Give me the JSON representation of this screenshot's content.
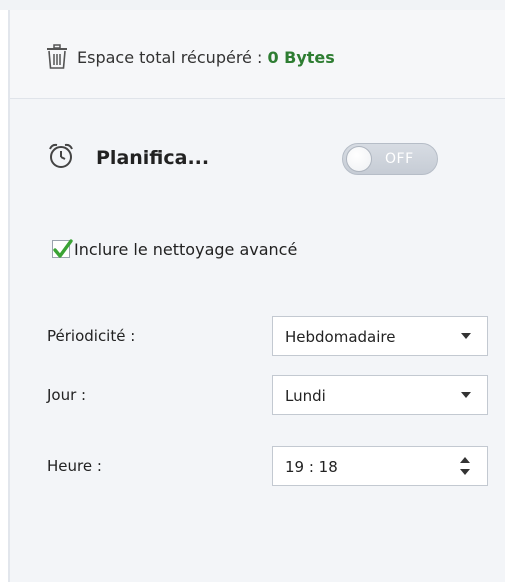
{
  "recovery": {
    "label": "Espace total récupéré : ",
    "value": "0 Bytes",
    "icon": "trash-icon",
    "value_color": "#2e7d32"
  },
  "schedule": {
    "title": "Planifica...",
    "icon": "alarm-clock-icon",
    "toggle_label": "OFF",
    "toggle_state": "off"
  },
  "advanced_cleaning": {
    "label": "Inclure le nettoyage avancé",
    "checked": true,
    "check_color": "#3aa335"
  },
  "fields": {
    "periodicity": {
      "label": "Périodicité :",
      "value": "Hebdomadaire"
    },
    "day": {
      "label": "Jour :",
      "value": "Lundi"
    },
    "time": {
      "label": "Heure :",
      "value": "19 : 18"
    }
  }
}
